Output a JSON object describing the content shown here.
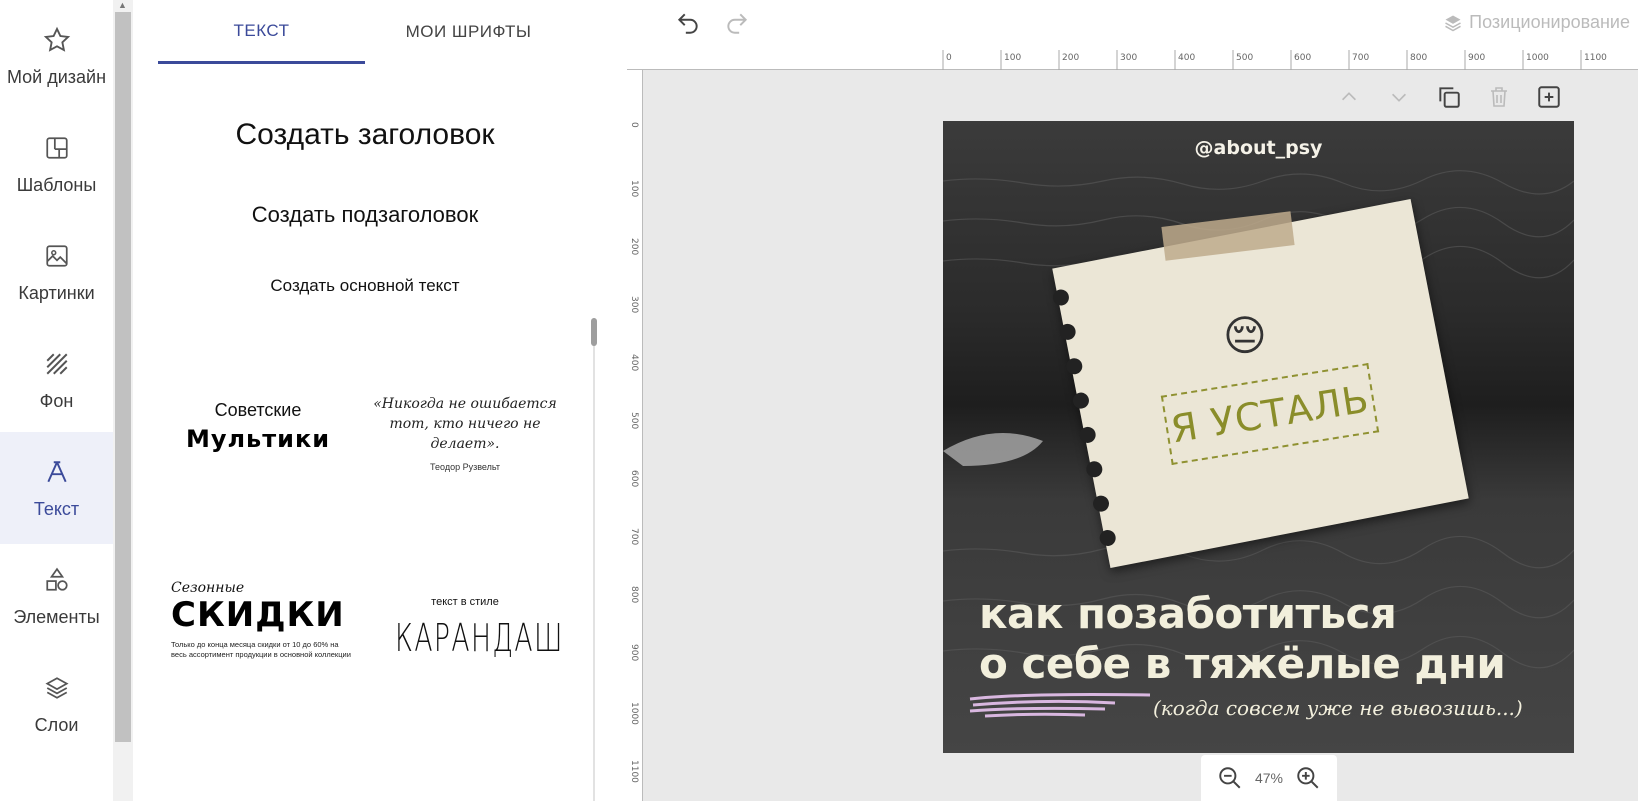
{
  "nav": {
    "items": [
      {
        "label": "Мой дизайн",
        "icon": "star-icon"
      },
      {
        "label": "Шаблоны",
        "icon": "template-icon"
      },
      {
        "label": "Картинки",
        "icon": "image-icon"
      },
      {
        "label": "Фон",
        "icon": "background-icon"
      },
      {
        "label": "Текст",
        "icon": "text-icon",
        "active": true
      },
      {
        "label": "Элементы",
        "icon": "shapes-icon"
      },
      {
        "label": "Слои",
        "icon": "layers-icon"
      }
    ]
  },
  "panel": {
    "tabs": [
      {
        "label": "ТЕКСТ",
        "active": true
      },
      {
        "label": "МОИ ШРИФТЫ"
      }
    ],
    "create_heading": "Создать заголовок",
    "create_subheading": "Создать подзаголовок",
    "create_body": "Создать основной текст",
    "presets": {
      "p1": {
        "line1": "Советские",
        "line2": "Мультики"
      },
      "p2": {
        "quote": "«Никогда не ошибается тот, кто ничего не делает».",
        "author": "Теодор Рузвельт"
      },
      "p3": {
        "line1": "Сезонные",
        "line2": "СКИДКИ",
        "small": "Только до конца месяца скидки от 10 до 60% на весь ассортимент продукции в основной коллекции"
      },
      "p4": {
        "line1": "текст в стиле",
        "line2": "КАРАНДАШ"
      }
    }
  },
  "topbar": {
    "positioning_label": "Позиционирование"
  },
  "rulers": {
    "top": [
      "0",
      "100",
      "200",
      "300",
      "400",
      "500",
      "600",
      "700",
      "800",
      "900",
      "1000",
      "1100"
    ],
    "left": [
      "0",
      "100",
      "200",
      "300",
      "400",
      "500",
      "600",
      "700",
      "800",
      "900",
      "1000",
      "1100"
    ]
  },
  "design": {
    "handle": "@about_psy",
    "emoji": "😔",
    "note_text": "Я УСТАЛЬ",
    "headline_line1": "как позаботиться",
    "headline_line2": "о себе в тяжёлые дни",
    "subline": "(когда совсем уже не вывозишь...)"
  },
  "zoom": {
    "value": "47%"
  },
  "colors": {
    "accent": "#3b4a9a",
    "panel_bg": "#ffffff",
    "workspace_bg": "#e9e9e9",
    "cream_text": "#f2efdc",
    "olive": "#8a8d2a"
  }
}
